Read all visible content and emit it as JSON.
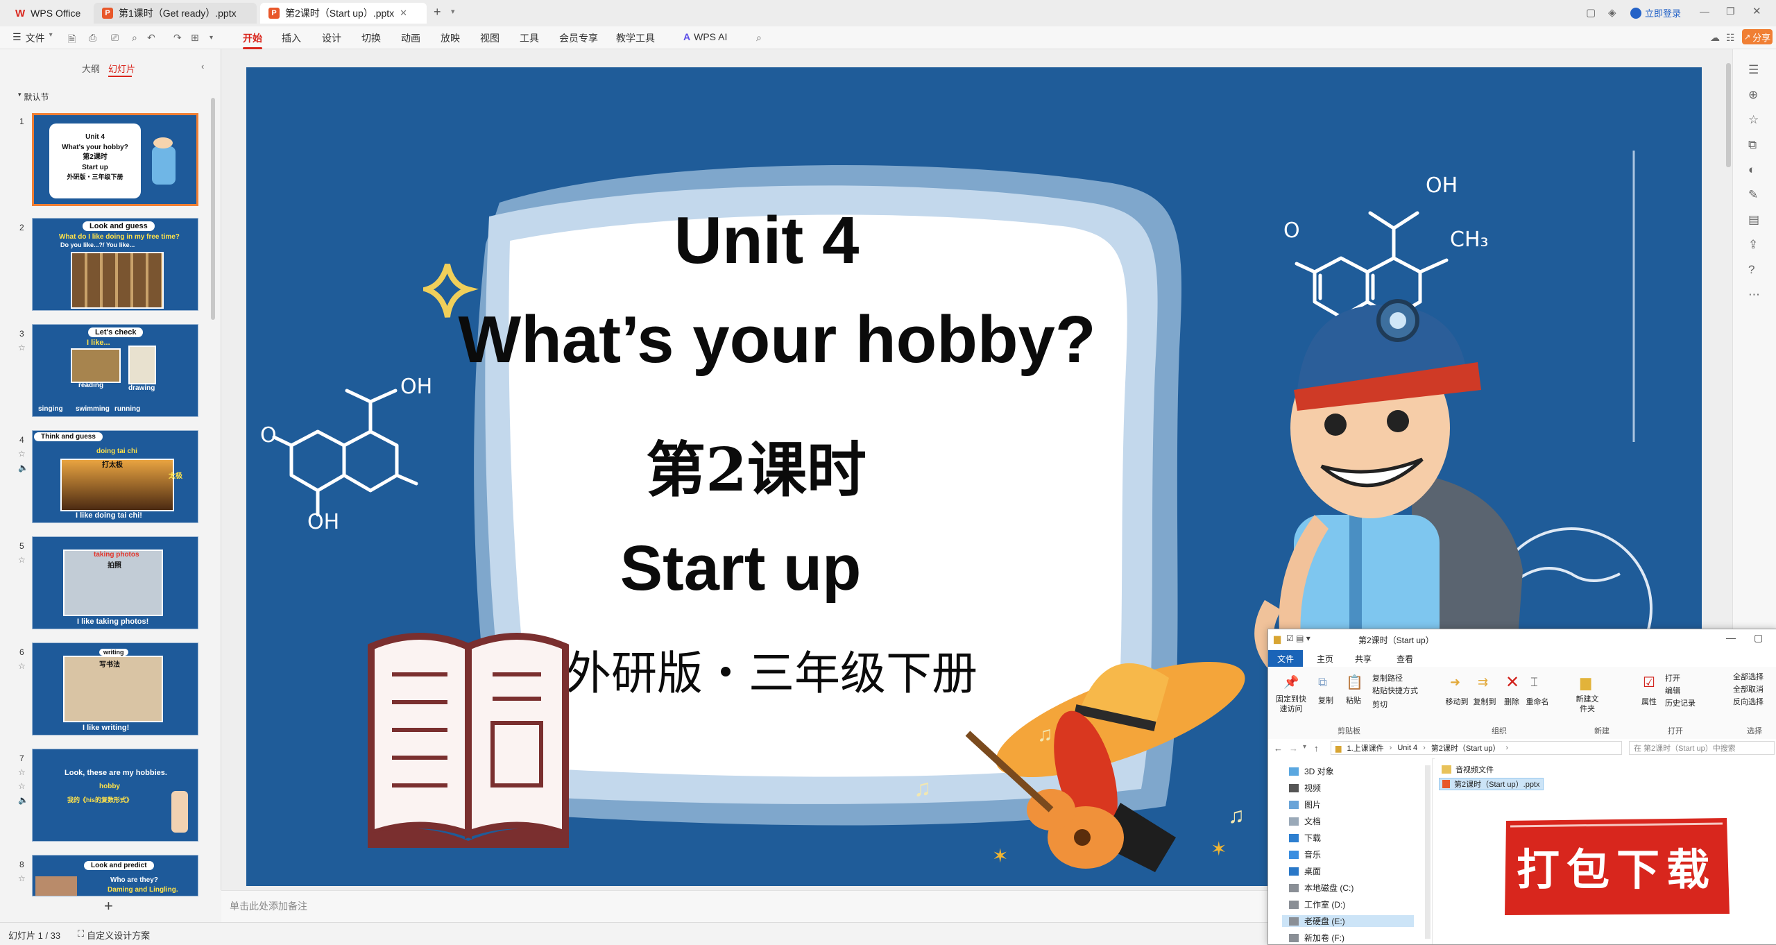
{
  "titlebar": {
    "tabs": [
      {
        "label": "WPS Office",
        "icon": "wps-logo-icon"
      },
      {
        "label": "第1课时（Get ready）.pptx",
        "icon": "ppt-file-icon"
      },
      {
        "label": "第2课时（Start up）.pptx",
        "icon": "ppt-file-icon",
        "active": true
      }
    ],
    "login_label": "立即登录"
  },
  "menubar": {
    "file_label": "文件",
    "items": [
      "开始",
      "插入",
      "设计",
      "切换",
      "动画",
      "放映",
      "视图",
      "工具",
      "会员专享",
      "教学工具",
      "WPS AI"
    ],
    "active_item": "开始",
    "share_label": "分享"
  },
  "left_panel": {
    "tabs": [
      "大纲",
      "幻灯片"
    ],
    "active_tab": "幻灯片",
    "section_label": "默认节",
    "thumbnails": [
      {
        "num": "1",
        "lines": [
          "Unit 4",
          "What's your hobby?",
          "第2课时",
          "Start up",
          "外研版・三年级下册"
        ]
      },
      {
        "num": "2",
        "pill": "Look and guess",
        "lines": [
          "What do I like doing in my free time?",
          "Do you like...?/ You like..."
        ]
      },
      {
        "num": "3",
        "pill": "Let's check",
        "lines": [
          "I like...",
          "reading",
          "drawing",
          "singing",
          "swimming",
          "running"
        ]
      },
      {
        "num": "4",
        "pill": "Think and guess",
        "lines": [
          "doing tai chi",
          "打太极",
          "I like doing tai chi!",
          "太极"
        ]
      },
      {
        "num": "5",
        "lines": [
          "taking photos",
          "拍照",
          "I like taking photos!"
        ]
      },
      {
        "num": "6",
        "lines": [
          "writing",
          "写书法",
          "I like writing!"
        ]
      },
      {
        "num": "7",
        "lines": [
          "Look, these are my hobbies.",
          "hobby",
          "我的《his的复数形式》"
        ]
      },
      {
        "num": "8",
        "pill": "Look and predict",
        "lines": [
          "Who are they?",
          "Daming and Lingling."
        ]
      }
    ]
  },
  "slide": {
    "title": "Unit 4",
    "subtitle": "What’s your hobby?",
    "lesson": "第2课时",
    "section": "Start up",
    "edition": "外研版・三年级下册",
    "formula_labels": [
      "OH",
      "O",
      "CH₃"
    ]
  },
  "notes_placeholder": "单击此处添加备注",
  "statusbar": {
    "slide_counter": "幻灯片 1 / 33",
    "design_label": "自定义设计方案"
  },
  "explorer": {
    "title": "第2课时（Start up）",
    "ribbon_tabs": [
      "文件",
      "主页",
      "共享",
      "查看"
    ],
    "ribbon_buttons": {
      "pin": "固定到快速访问",
      "copy": "复制",
      "paste": "粘贴",
      "copy_path": "复制路径",
      "paste_shortcut": "粘贴快捷方式",
      "cut": "剪切",
      "move_to": "移动到",
      "copy_to": "复制到",
      "delete": "删除",
      "rename": "重命名",
      "new_folder": "新建文件夹",
      "properties": "属性",
      "open": "打开",
      "edit": "编辑",
      "history": "历史记录",
      "select_all": "全部选择",
      "select_none": "全部取消",
      "invert": "反向选择"
    },
    "ribbon_groups": [
      "剪贴板",
      "组织",
      "新建",
      "打开",
      "选择"
    ],
    "breadcrumb": [
      "1.上课课件",
      "Unit 4",
      "第2课时（Start up）"
    ],
    "search_placeholder": "在 第2课时（Start up）中搜索",
    "nav_items": [
      "3D 对象",
      "视频",
      "图片",
      "文档",
      "下载",
      "音乐",
      "桌面",
      "本地磁盘 (C:)",
      "工作室 (D:)",
      "老硬盘 (E:)",
      "新加卷 (F:)"
    ],
    "files": [
      "音视频文件",
      "第2课时（Start up）.pptx"
    ]
  },
  "download_badge": "打包下载",
  "colors": {
    "accent": "#d9251c",
    "slide_bg": "#1f5c99",
    "selection": "#f07f34",
    "badge_red": "#d8261d"
  }
}
